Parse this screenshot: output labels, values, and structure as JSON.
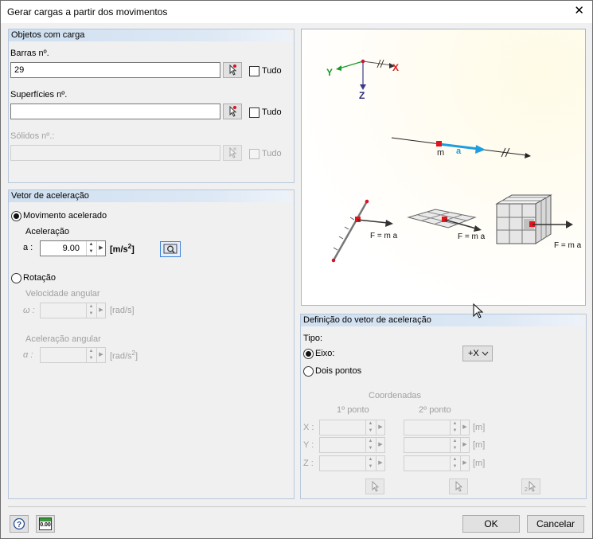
{
  "dialog": {
    "title": "Gerar cargas a partir dos movimentos",
    "close_glyph": "✕"
  },
  "loaded_objects": {
    "heading": "Objetos com carga",
    "members": {
      "label": "Barras nº.",
      "value": "29",
      "all_label": "Tudo"
    },
    "surfaces": {
      "label": "Superfícies nº.",
      "value": "",
      "all_label": "Tudo"
    },
    "solids": {
      "label": "Sólidos nº.:",
      "value": "",
      "all_label": "Tudo"
    }
  },
  "acceleration_vector": {
    "heading": "Vetor de aceleração",
    "accelerated_label": "Movimento acelerado",
    "acceleration_label": "Aceleração",
    "a_label": "a :",
    "a_value": "9.00",
    "a_unit": "[m/s",
    "a_unit_exp": "2",
    "a_unit_close": "]",
    "rotation_label": "Rotação",
    "angular_velocity_label": "Velocidade angular",
    "omega_label": "ω :",
    "omega_unit": "[rad/s]",
    "angular_acc_label": "Aceleração angular",
    "alpha_label": "α :",
    "alpha_unit": "[rad/s",
    "alpha_unit_exp": "2",
    "alpha_unit_close": "]"
  },
  "diagram": {
    "axis_x": "X",
    "axis_y": "Y",
    "axis_z": "Z",
    "mass_label": "m",
    "acc_label": "a",
    "force_label": "F = m a"
  },
  "definition": {
    "heading": "Definição do vetor de aceleração",
    "type_label": "Tipo:",
    "axis_label": "Eixo:",
    "axis_value": "+X",
    "two_points_label": "Dois pontos",
    "coords_label": "Coordenadas",
    "p1_label": "1º ponto",
    "p2_label": "2º ponto",
    "x_label": "X :",
    "y_label": "Y :",
    "z_label": "Z :",
    "unit": "[m]"
  },
  "footer": {
    "ok_label": "OK",
    "cancel_label": "Cancelar",
    "units_icon_text": "0.00"
  },
  "colors": {
    "accent": "#4a7bb7",
    "panel_header": "#d6e4f3",
    "arrow_blue": "#1e9ee0",
    "marker_red": "#e0141e"
  }
}
